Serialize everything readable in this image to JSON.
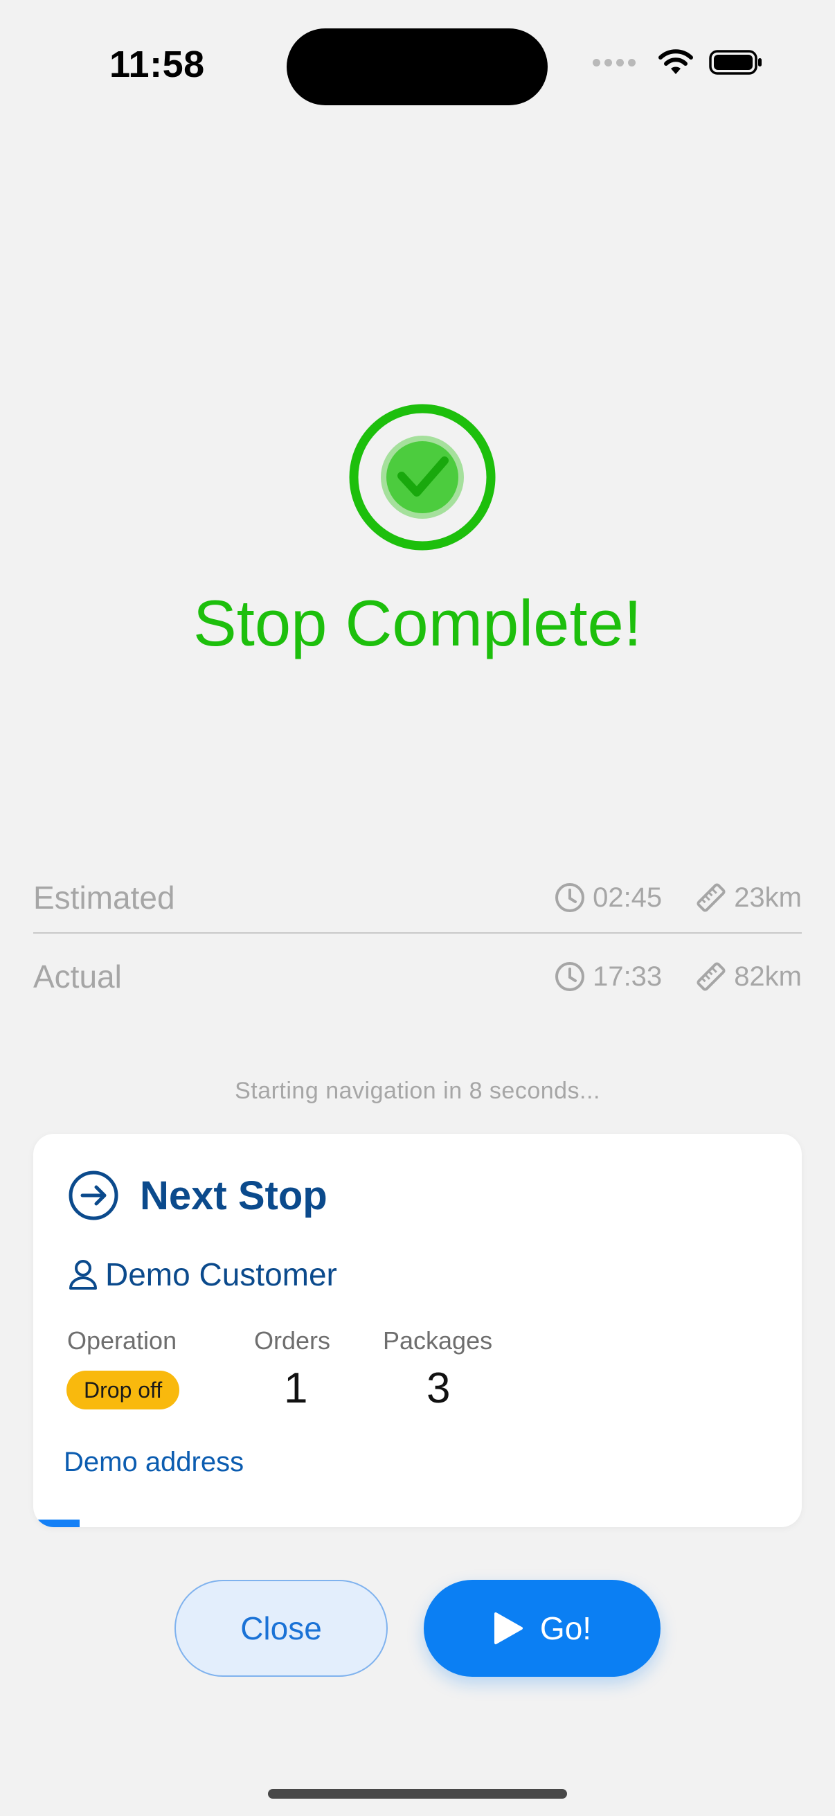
{
  "status_bar": {
    "time": "11:58",
    "icons": [
      "cellular-signal-icon",
      "wifi-icon",
      "battery-icon"
    ]
  },
  "completion": {
    "icon": "check-circle-icon",
    "title": "Stop Complete!",
    "accent_color": "#1dbf0c"
  },
  "stats": {
    "estimated": {
      "label": "Estimated",
      "time": "02:45",
      "distance": "23km"
    },
    "actual": {
      "label": "Actual",
      "time": "17:33",
      "distance": "82km"
    }
  },
  "countdown_text": "Starting navigation in 8 seconds...",
  "next_stop": {
    "title": "Next Stop",
    "customer": "Demo Customer",
    "columns": {
      "operation": "Operation",
      "orders": "Orders",
      "packages": "Packages"
    },
    "operation_badge": "Drop off",
    "orders_count": "1",
    "packages_count": "3",
    "address": "Demo address",
    "countdown_progress": 0.06
  },
  "buttons": {
    "close": "Close",
    "go": "Go!"
  },
  "colors": {
    "primary_blue": "#0b7ff3",
    "navy": "#0b4a8c",
    "badge_yellow": "#f9b90d"
  }
}
